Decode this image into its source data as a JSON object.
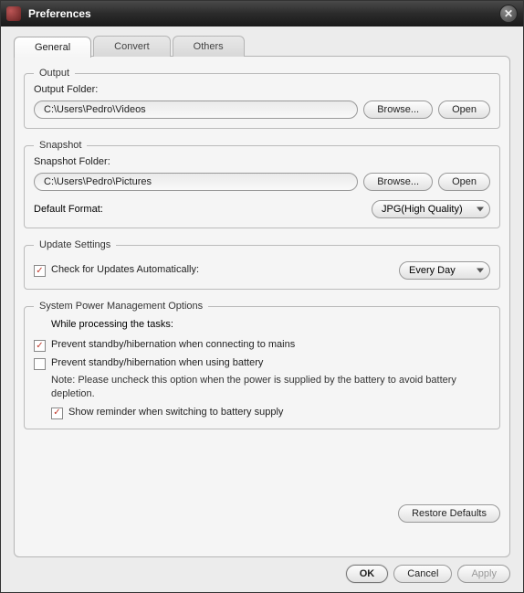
{
  "window": {
    "title": "Preferences"
  },
  "tabs": {
    "general": "General",
    "convert": "Convert",
    "others": "Others"
  },
  "output": {
    "legend": "Output",
    "folder_label": "Output Folder:",
    "folder_value": "C:\\Users\\Pedro\\Videos",
    "browse": "Browse...",
    "open": "Open"
  },
  "snapshot": {
    "legend": "Snapshot",
    "folder_label": "Snapshot Folder:",
    "folder_value": "C:\\Users\\Pedro\\Pictures",
    "browse": "Browse...",
    "open": "Open",
    "format_label": "Default Format:",
    "format_value": "JPG(High Quality)"
  },
  "updates": {
    "legend": "Update Settings",
    "check_label": "Check for Updates Automatically:",
    "frequency": "Every Day"
  },
  "power": {
    "legend": "System Power Management Options",
    "while": "While processing the tasks:",
    "mains": "Prevent standby/hibernation when connecting to mains",
    "battery": "Prevent standby/hibernation when using battery",
    "note": "Note: Please uncheck this option when the power is supplied by the battery to avoid battery depletion.",
    "reminder": "Show reminder when switching to battery supply"
  },
  "buttons": {
    "restore": "Restore Defaults",
    "ok": "OK",
    "cancel": "Cancel",
    "apply": "Apply"
  }
}
